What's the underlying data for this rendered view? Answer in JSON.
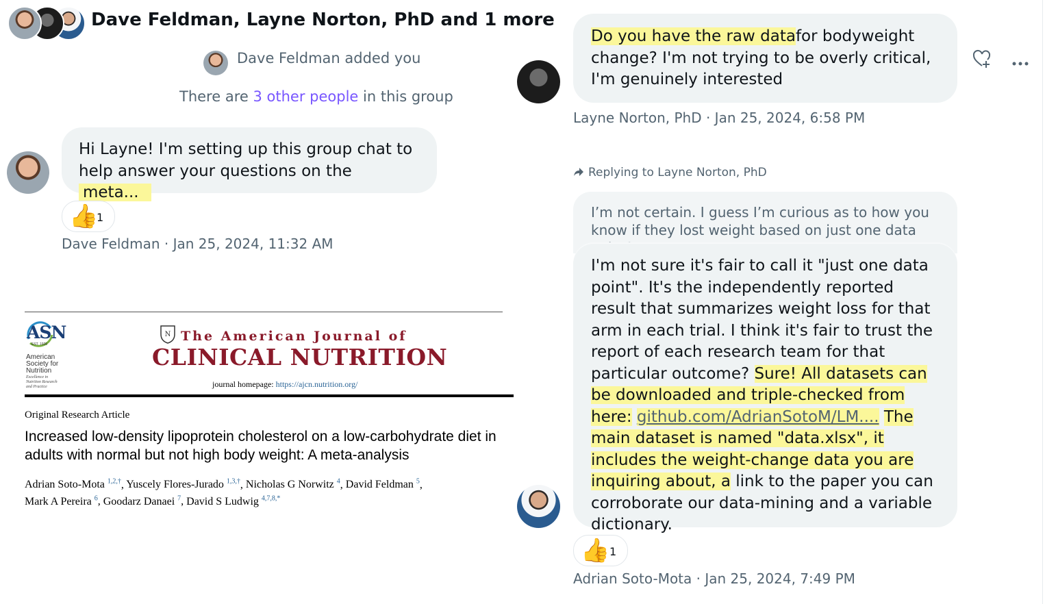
{
  "header": {
    "title": "Dave Feldman, Layne Norton, PhD and 1 more"
  },
  "system": {
    "added_text": "Dave Feldman added you",
    "group_prefix": "There are",
    "group_link": "3 other people",
    "group_suffix": "in this group"
  },
  "messages": {
    "dave": {
      "text_1": "Hi Layne! I'm setting up this group chat to help answer your questions on the",
      "text_highlight": "meta...",
      "reaction_count": "1",
      "meta": "Dave Feldman · Jan 25, 2024, 11:32 AM"
    },
    "layne": {
      "text_highlight": "Do you have the raw data",
      "text_rest": "for bodyweight change? I'm not trying to be overly critical, I'm genuinely interested",
      "meta": "Layne Norton, PhD · Jan 25, 2024, 6:58 PM"
    },
    "adrian": {
      "reply_label": "Replying to Layne Norton, PhD",
      "quoted": "I’m not certain. I guess I’m curious as to how you know if they lost weight based on just one data point?",
      "text_1": "I'm not sure it's fair to call it \"just one data point\". It's the independently reported result that summarizes weight loss for that arm in each trial. I think it's fair to trust the report of each research team for that particular outcome?",
      "text_hl_1": "Sure! All datasets can be downloaded and triple-checked from here:",
      "link": "github.com/AdrianSotoM/LM....",
      "text_hl_2": "The main dataset is named \"data.xlsx\", it includes the weight-change data you are inquiring about, a",
      "text_2": "link to the paper you can corroborate our data-mining and a variable dictionary.",
      "reaction_count": "1",
      "meta": "Adrian Soto-Mota · Jan 25, 2024, 7:49 PM"
    }
  },
  "paper": {
    "asn_logo": "ASN",
    "asn_est": "EST. 1928",
    "asn_name": "American Society for Nutrition",
    "asn_tagline": "Excellence in Nutrition Research and Practice",
    "journal_top": "The American Journal of",
    "journal_main": "CLINICAL NUTRITION",
    "homepage_label": "journal homepage:",
    "homepage_url": "https://ajcn.nutrition.org/",
    "article_type": "Original Research Article",
    "title": "Increased low-density lipoprotein cholesterol on a low-carbohydrate diet in adults with normal but not high body weight: A meta-analysis",
    "authors": [
      {
        "name": "Adrian Soto-Mota",
        "sup": "1,2,†"
      },
      {
        "name": "Yuscely Flores-Jurado",
        "sup": "1,3,†"
      },
      {
        "name": "Nicholas G Norwitz",
        "sup": "4"
      },
      {
        "name": "David Feldman",
        "sup": "5"
      },
      {
        "name": "Mark A Pereira",
        "sup": "6"
      },
      {
        "name": "Goodarz Danaei",
        "sup": "7"
      },
      {
        "name": "David S Ludwig",
        "sup": "4,7,8,*"
      }
    ]
  },
  "icons": {
    "like": "heart-plus-icon",
    "more": "more-dots-icon",
    "reply": "reply-arrow-icon",
    "reaction": "thumbs-up-emoji"
  },
  "colors": {
    "bubble": "#eff3f4",
    "highlight": "#fbf79a",
    "link": "#7856ff",
    "journal": "#8a1a2a"
  }
}
